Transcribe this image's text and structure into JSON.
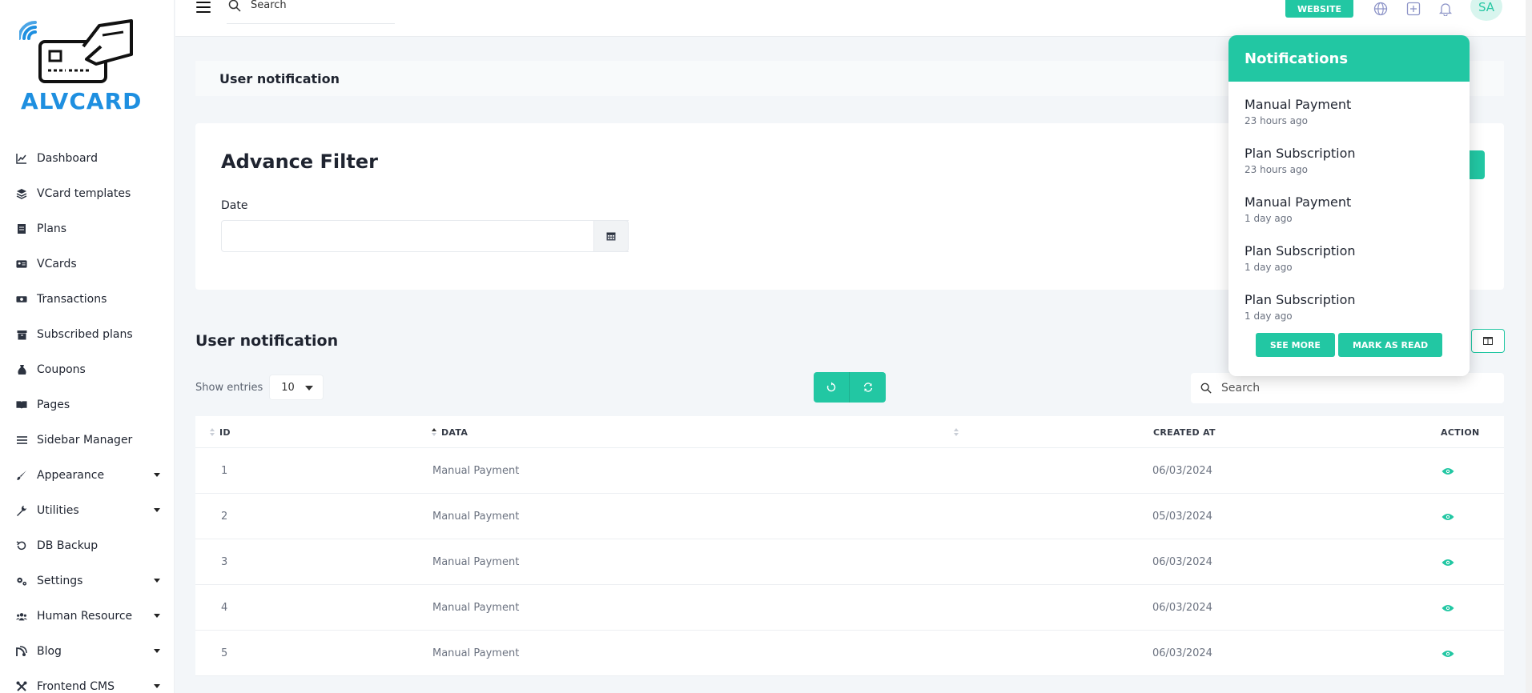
{
  "sidebar": {
    "logo_text": "ALVCARD",
    "items": [
      {
        "label": "Dashboard",
        "icon": "chart-line-icon",
        "has_caret": false
      },
      {
        "label": "VCard templates",
        "icon": "layers-icon",
        "has_caret": false
      },
      {
        "label": "Plans",
        "icon": "document-icon",
        "has_caret": false
      },
      {
        "label": "VCards",
        "icon": "id-card-icon",
        "has_caret": false
      },
      {
        "label": "Transactions",
        "icon": "money-icon",
        "has_caret": false
      },
      {
        "label": "Subscribed plans",
        "icon": "archive-icon",
        "has_caret": false
      },
      {
        "label": "Coupons",
        "icon": "money-bag-icon",
        "has_caret": false
      },
      {
        "label": "Pages",
        "icon": "book-icon",
        "has_caret": false
      },
      {
        "label": "Sidebar Manager",
        "icon": "bars-icon",
        "has_caret": false
      },
      {
        "label": "Appearance",
        "icon": "brush-icon",
        "has_caret": true
      },
      {
        "label": "Utilities",
        "icon": "wrench-icon",
        "has_caret": true
      },
      {
        "label": "DB Backup",
        "icon": "history-icon",
        "has_caret": false
      },
      {
        "label": "Settings",
        "icon": "gears-icon",
        "has_caret": true
      },
      {
        "label": "Human Resource",
        "icon": "users-icon",
        "has_caret": true
      },
      {
        "label": "Blog",
        "icon": "blog-icon",
        "has_caret": true
      },
      {
        "label": "Frontend CMS",
        "icon": "tools-icon",
        "has_caret": true
      }
    ]
  },
  "topbar": {
    "search_placeholder": "Search",
    "website_label": "WEBSITE",
    "avatar_initials": "SA"
  },
  "page": {
    "breadcrumb": "User notification",
    "filter_title": "Advance Filter",
    "date_label": "Date",
    "date_value": "",
    "table_title": "User notification",
    "show_entries_label": "Show entries",
    "entries_value": "10",
    "table_search_placeholder": "Search"
  },
  "table": {
    "headers": {
      "id": "ID",
      "data": "DATA",
      "created_at": "CREATED AT",
      "action": "ACTION"
    },
    "rows": [
      {
        "id": "1",
        "data": "Manual Payment",
        "created_at": "06/03/2024"
      },
      {
        "id": "2",
        "data": "Manual Payment",
        "created_at": "05/03/2024"
      },
      {
        "id": "3",
        "data": "Manual Payment",
        "created_at": "06/03/2024"
      },
      {
        "id": "4",
        "data": "Manual Payment",
        "created_at": "06/03/2024"
      },
      {
        "id": "5",
        "data": "Manual Payment",
        "created_at": "06/03/2024"
      }
    ]
  },
  "notifications": {
    "title": "Notifications",
    "items": [
      {
        "title": "Manual Payment",
        "time": "23 hours ago"
      },
      {
        "title": "Plan Subscription",
        "time": "23 hours ago"
      },
      {
        "title": "Manual Payment",
        "time": "1 day ago"
      },
      {
        "title": "Plan Subscription",
        "time": "1 day ago"
      },
      {
        "title": "Plan Subscription",
        "time": "1 day ago"
      }
    ],
    "see_more_label": "SEE MORE",
    "mark_read_label": "MARK AS READ"
  },
  "colors": {
    "accent": "#22c7a3",
    "logo_blue": "#1e8fe0",
    "background": "#f3f6f9"
  }
}
